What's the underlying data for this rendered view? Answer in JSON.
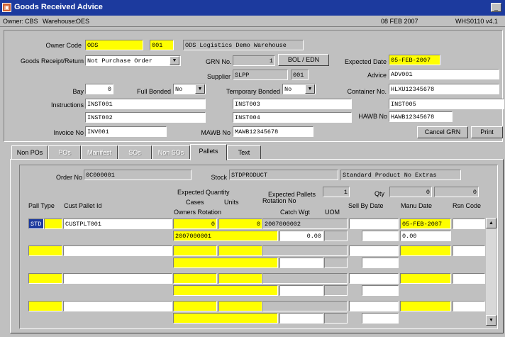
{
  "window": {
    "title": "Goods Received Advice",
    "icon": "app-icon",
    "minimize_label": "_"
  },
  "infobar": {
    "owner_label": "Owner:",
    "owner": "CBS",
    "warehouse_label": "Warehouse:",
    "warehouse": "OES",
    "date": "08 FEB 2007",
    "screen_id": "WHS0110  v4.1"
  },
  "header": {
    "owner_code_label": "Owner Code",
    "owner_code": "ODS",
    "owner_code2": "001",
    "owner_name": "ODS Logistics Demo Warehouse",
    "receipt_return_label": "Goods Receipt/Return",
    "receipt_return_value": "Not Purchase Order",
    "grn_label": "GRN No.",
    "grn_value": "1",
    "bol_edn_button": "BOL / EDN",
    "expected_date_label": "Expected Date",
    "expected_date": "05-FEB-2007",
    "supplier_label": "Supplier",
    "supplier": "SLPP",
    "supplier2": "001",
    "advice_label": "Advice",
    "advice": "ADV001",
    "bay_label": "Bay",
    "bay": "0",
    "full_bonded_label": "Full Bonded",
    "full_bonded": "No",
    "temp_bonded_label": "Temporary Bonded",
    "temp_bonded": "No",
    "container_label": "Container No.",
    "container": "HLXU12345678",
    "instructions_label": "Instructions",
    "instructions": [
      "INST001",
      "INST003",
      "INST005",
      "INST002",
      "INST004"
    ],
    "hawb_label": "HAWB No",
    "hawb": "HAWB12345678",
    "invoice_label": "Invoice No",
    "invoice": "INV001",
    "mawb_label": "MAWB No",
    "mawb": "MAWB12345678",
    "cancel_grn_button": "Cancel GRN",
    "print_button": "Print"
  },
  "tabs": [
    {
      "label": "Non POs",
      "state": "normal"
    },
    {
      "label": "POs",
      "state": "disabled"
    },
    {
      "label": "Manifest",
      "state": "disabled"
    },
    {
      "label": "SOs",
      "state": "disabled"
    },
    {
      "label": "Non SOs",
      "state": "disabled"
    },
    {
      "label": "Pallets",
      "state": "active"
    },
    {
      "label": "Text",
      "state": "normal"
    }
  ],
  "pallets": {
    "order_label": "Order No",
    "order_value": "0C000001",
    "stock_label": "Stock",
    "stock_value": "STDPRODUCT",
    "stock_desc": "Standard Product No Extras",
    "expected_qty_label": "Expected Quantity",
    "cases_label": "Cases",
    "units_label": "Units",
    "expected_pallets_label": "Expected Pallets",
    "expected_pallets": "1",
    "qty_label": "Qty",
    "qty_value1": "0",
    "qty_value2": "0",
    "rotation_no_label": "Rotation No",
    "pall_type_label": "Pall Type",
    "cust_pallet_label": "Cust Pallet Id",
    "owners_rotation_label": "Owners Rotation",
    "catch_wgt_label": "Catch Wgt",
    "uom_label": "UOM",
    "sell_by_label": "Sell By Date",
    "manu_date_label": "Manu Date",
    "rsn_code_label": "Rsn Code",
    "row1": {
      "pall_type": "STD",
      "cust_pallet": "CUSTPLT001",
      "cases": "0",
      "units": "0",
      "rotation_no": "2007000002",
      "manu_date": "05-FEB-2007",
      "owners_rotation": "2007000001",
      "catch_wgt": "0.00",
      "extra": "0.00"
    }
  },
  "colors": {
    "title_bar": "#1c3a9e",
    "mandatory_field": "#ffff00",
    "window_bg": "#c0c0c0"
  }
}
